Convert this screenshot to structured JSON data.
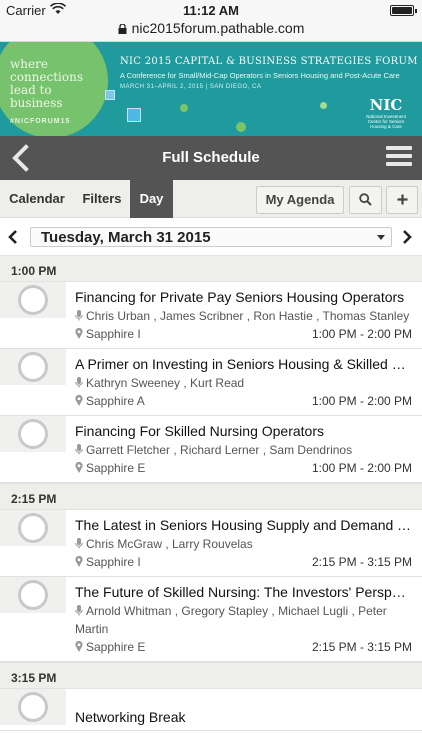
{
  "status": {
    "carrier": "Carrier",
    "time": "11:12 AM"
  },
  "browser": {
    "url": "nic2015forum.pathable.com"
  },
  "banner": {
    "tagline": "where connections lead to business",
    "hashtag": "#NICFORUM15",
    "forum_title": "NIC 2015 CAPITAL & BUSINESS STRATEGIES FORUM",
    "forum_subtitle": "A Conference for Small/Mid-Cap Operators in Seniors Housing and Post-Acute Care",
    "forum_dates": "MARCH 31–APRIL 2, 2015  |  SAN DIEGO, CA",
    "logo": "NIC",
    "logo_sub": "National Investment Center for Seniors Housing & Care"
  },
  "header": {
    "title": "Full Schedule",
    "back_icon": "chevron-left-icon",
    "menu_icon": "hamburger-icon"
  },
  "tabs": {
    "calendar": "Calendar",
    "filters": "Filters",
    "day": "Day",
    "my_agenda": "My Agenda",
    "search_icon": "search-icon",
    "add_icon": "plus-icon"
  },
  "date_nav": {
    "selected_date": "Tuesday, March 31 2015"
  },
  "schedule": [
    {
      "time": "1:00 PM",
      "sessions": [
        {
          "title": "Financing for Private Pay Seniors Housing Operators",
          "speakers": "Chris Urban ,  James Scribner ,  Ron Hastie ,  Thomas Stanley",
          "room": "Sapphire I",
          "time": "1:00 PM - 2:00 PM"
        },
        {
          "title": "A Primer on Investing in Seniors Housing & Skilled Nursing",
          "speakers": "Kathryn Sweeney ,  Kurt Read",
          "room": "Sapphire A",
          "time": "1:00 PM - 2:00 PM"
        },
        {
          "title": "Financing For Skilled Nursing Operators",
          "speakers": "Garrett Fletcher ,  Richard Lerner ,  Sam Dendrinos",
          "room": "Sapphire E",
          "time": "1:00 PM - 2:00 PM"
        }
      ]
    },
    {
      "time": "2:15 PM",
      "sessions": [
        {
          "title": "The Latest in Seniors Housing Supply and Demand Trends",
          "speakers": "Chris McGraw ,  Larry Rouvelas",
          "room": "Sapphire I",
          "time": "2:15 PM - 3:15 PM"
        },
        {
          "title": "The Future of Skilled Nursing: The Investors' Perspective",
          "speakers": "Arnold Whitman ,  Gregory Stapley ,  Michael Lugli ,  Peter Martin",
          "room": "Sapphire E",
          "time": "2:15 PM - 3:15 PM"
        }
      ]
    },
    {
      "time": "3:15 PM",
      "sessions": [
        {
          "title": "Networking Break",
          "speakers": "",
          "room": "",
          "time": ""
        }
      ]
    }
  ]
}
